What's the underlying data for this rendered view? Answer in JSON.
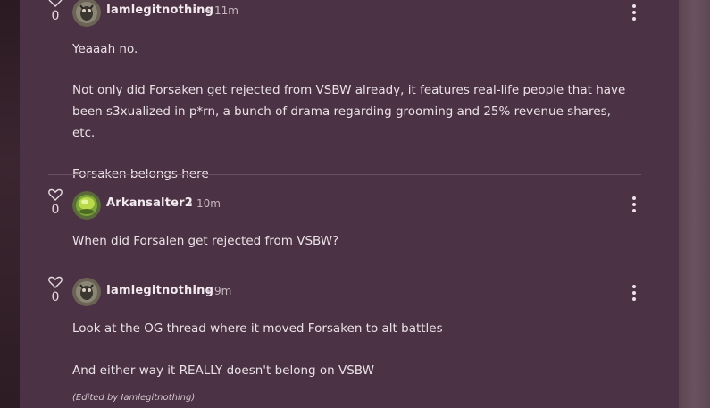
{
  "comments": [
    {
      "username": "Iamlegitnothing",
      "separator": "•",
      "time": "11m",
      "likes": "0",
      "paragraphs": [
        "Yeaaah no.",
        "Not only did Forsaken get rejected from VSBW already, it features real-life people that have been s3xualized in p*rn, a bunch of drama regarding grooming and 25% revenue shares, etc.",
        "Forsaken belongs here"
      ]
    },
    {
      "username": "Arkansalter2",
      "separator": "•",
      "time": "10m",
      "likes": "0",
      "paragraphs": [
        "When did Forsalen get rejected from VSBW?"
      ]
    },
    {
      "username": "Iamlegitnothing",
      "separator": "•",
      "time": "9m",
      "likes": "0",
      "paragraphs": [
        "Look at the OG thread where it moved Forsaken to alt battles",
        "And either way it REALLY doesn't belong on VSBW"
      ],
      "edited": "(Edited by Iamlegitnothing)"
    }
  ],
  "icons": {
    "like": "heart-outline-icon",
    "more": "vertical-ellipsis-icon"
  },
  "colors": {
    "panel": "#4b3244",
    "text": "#ebe2e8",
    "muted": "#c6b6c0",
    "divider": "#6a5060"
  }
}
